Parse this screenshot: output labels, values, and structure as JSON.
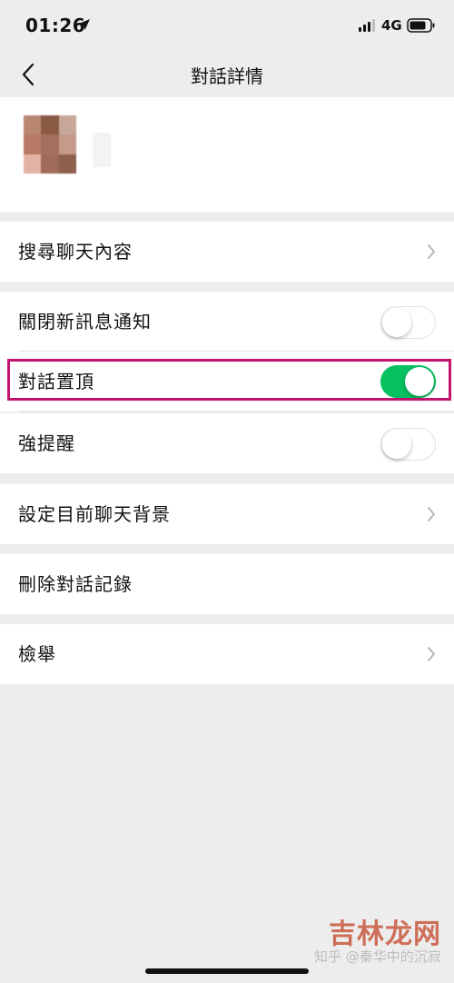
{
  "status_bar": {
    "time": "01:26",
    "network": "4G"
  },
  "nav": {
    "title": "對話詳情"
  },
  "rows": [
    {
      "label": "搜尋聊天內容",
      "control": "chevron"
    },
    {
      "label": "關閉新訊息通知",
      "control": "toggle",
      "toggle_on": false
    },
    {
      "label": "對話置頂",
      "control": "toggle",
      "toggle_on": true
    },
    {
      "label": "強提醒",
      "control": "toggle",
      "toggle_on": false
    },
    {
      "label": "設定目前聊天背景",
      "control": "chevron"
    },
    {
      "label": "刪除對話記錄",
      "control": "none"
    },
    {
      "label": "檢舉",
      "control": "chevron"
    }
  ],
  "colors": {
    "toggle_on": "#07c160",
    "highlight_border": "#c2136e",
    "page_background": "#ededed"
  },
  "watermark": {
    "zhihu": "知乎 @秦华中的沉寂",
    "site": "吉林龙网"
  }
}
